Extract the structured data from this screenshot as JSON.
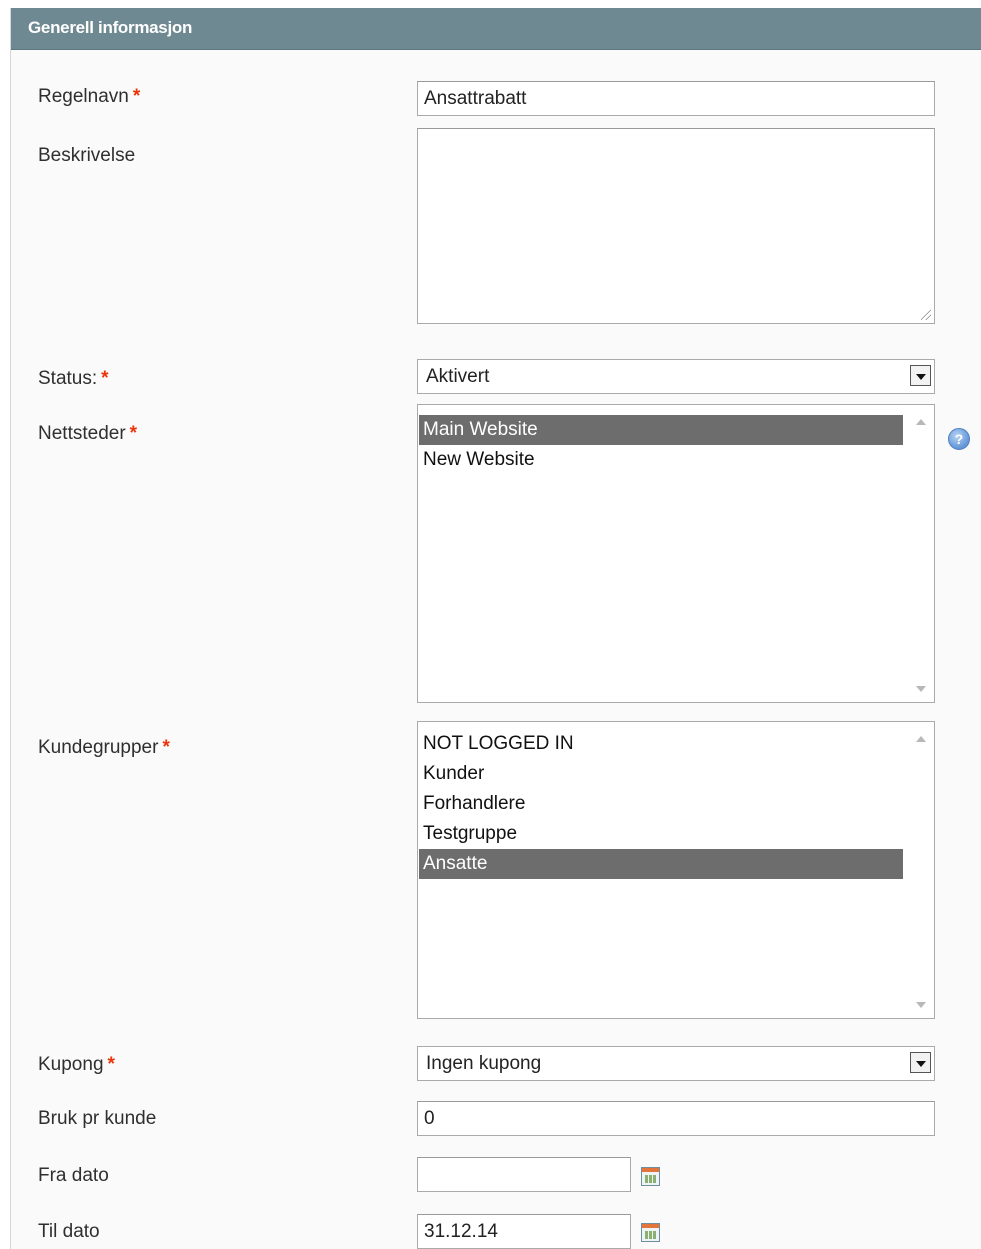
{
  "panel": {
    "title": "Generell informasjon"
  },
  "fields": {
    "rule_name": {
      "label": "Regelnavn",
      "required": "*",
      "value": "Ansattrabatt"
    },
    "description": {
      "label": "Beskrivelse",
      "value": ""
    },
    "status": {
      "label": "Status:",
      "required": "*",
      "value": "Aktivert"
    },
    "websites": {
      "label": "Nettsteder",
      "required": "*",
      "options": [
        "Main Website",
        "New Website"
      ],
      "selected": [
        "Main Website"
      ]
    },
    "customer_groups": {
      "label": "Kundegrupper",
      "required": "*",
      "options": [
        "NOT LOGGED IN",
        "Kunder",
        "Forhandlere",
        "Testgruppe",
        "Ansatte"
      ],
      "selected": [
        "Ansatte"
      ]
    },
    "coupon": {
      "label": "Kupong",
      "required": "*",
      "value": "Ingen kupong"
    },
    "uses_per_customer": {
      "label": "Bruk pr kunde",
      "value": "0"
    },
    "from_date": {
      "label": "Fra dato",
      "value": ""
    },
    "to_date": {
      "label": "Til dato",
      "value": "31.12.14"
    }
  },
  "icons": {
    "help": "help-icon",
    "calendar": "calendar-icon",
    "dropdown": "chevron-down-icon"
  },
  "colors": {
    "header": "#6f8992",
    "required": "#eb340a",
    "selected_row": "#6d6d6d"
  }
}
